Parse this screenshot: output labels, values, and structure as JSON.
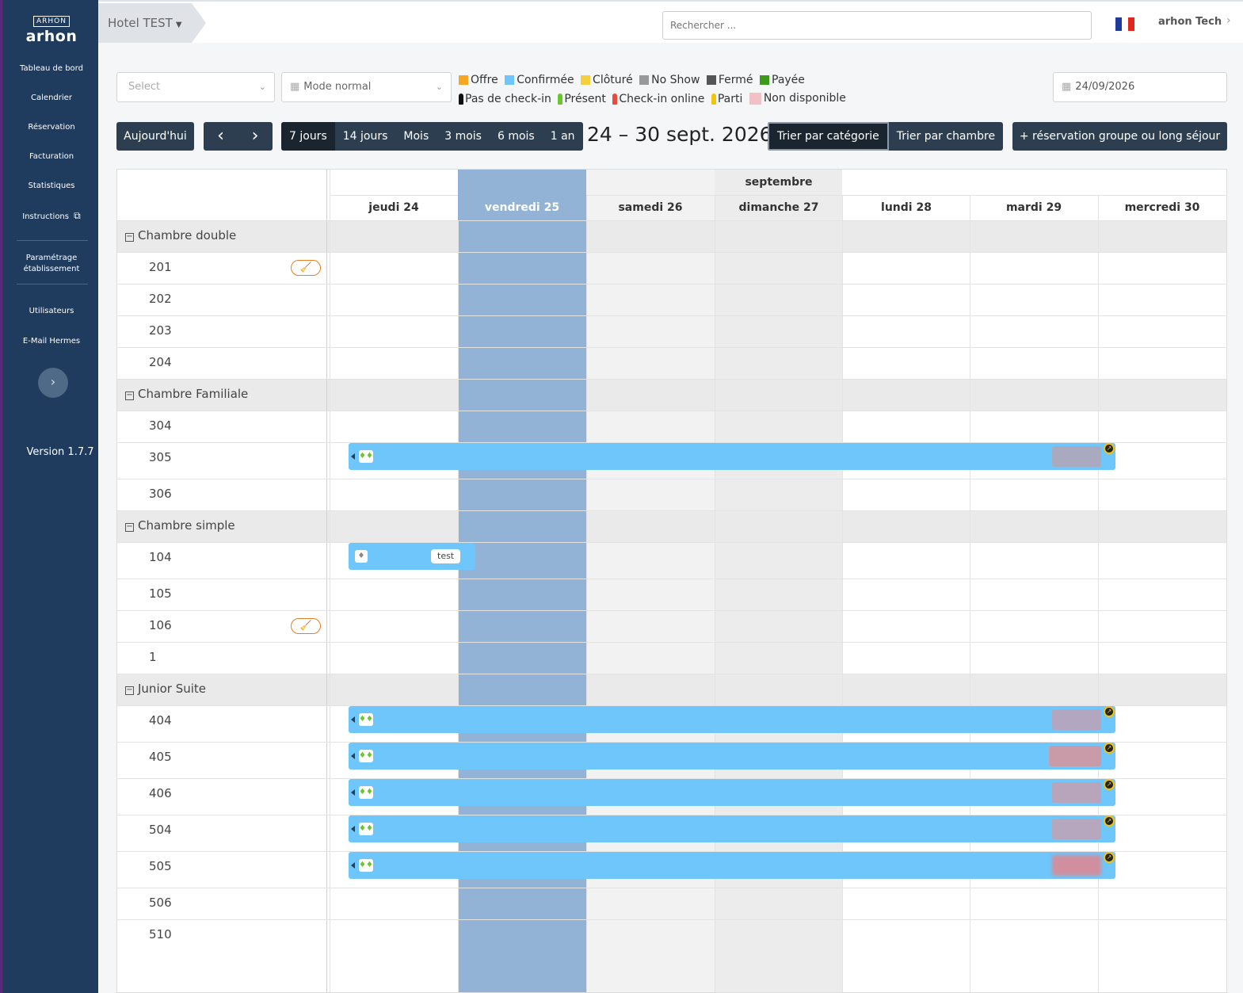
{
  "sidebar": {
    "logo_mark": "ARHON",
    "logo_text": "arhon",
    "items": [
      {
        "label": "Tableau de bord"
      },
      {
        "label": "Calendrier"
      },
      {
        "label": "Réservation"
      },
      {
        "label": "Facturation"
      },
      {
        "label": "Statistiques"
      },
      {
        "label": "Instructions"
      },
      {
        "label": "Paramétrage établissement"
      },
      {
        "label": "Utilisateurs"
      },
      {
        "label": "E-Mail Hermes"
      }
    ],
    "version": "Version 1.7.7"
  },
  "topbar": {
    "hotel": "Hotel TEST",
    "search_placeholder": "Rechercher ...",
    "user": "arhon Tech"
  },
  "filters": {
    "select_placeholder": "Select",
    "mode": "Mode normal",
    "date": "24/09/2026"
  },
  "legend": {
    "statuses": [
      {
        "label": "Offre",
        "color": "#f5a623"
      },
      {
        "label": "Confirmée",
        "color": "#6ec6fb"
      },
      {
        "label": "Clôturé",
        "color": "#f4d03f"
      },
      {
        "label": "No Show",
        "color": "#999999"
      },
      {
        "label": "Fermé",
        "color": "#555555"
      },
      {
        "label": "Payée",
        "color": "#3a9a1a"
      }
    ],
    "checkins": [
      {
        "label": "Pas de check-in",
        "color": "#111111"
      },
      {
        "label": "Présent",
        "color": "#6cc52d"
      },
      {
        "label": "Check-in online",
        "color": "#e74c3c"
      },
      {
        "label": "Parti",
        "color": "#f1c40f"
      },
      {
        "label": "Non disponible",
        "color": "#f2c1c5"
      }
    ]
  },
  "toolbar": {
    "today": "Aujourd'hui",
    "prev": "‹",
    "next": "›",
    "views": [
      "7 jours",
      "14 jours",
      "Mois",
      "3 mois",
      "6 mois",
      "1 an"
    ],
    "active_view": "7 jours",
    "range_title": "24 – 30 sept. 2026",
    "sort_category": "Trier par catégorie",
    "sort_room": "Trier par chambre",
    "group_booking": "+ réservation groupe ou long séjour"
  },
  "calendar": {
    "month": "septembre",
    "days": [
      "jeudi 24",
      "vendredi 25",
      "samedi 26",
      "dimanche 27",
      "lundi 28",
      "mardi 29",
      "mercredi 30"
    ],
    "today_index": 1,
    "categories": [
      {
        "name": "Chambre double",
        "rooms": [
          "201",
          "202",
          "203",
          "204"
        ]
      },
      {
        "name": "Chambre Familiale",
        "rooms": [
          "304",
          "305",
          "306"
        ]
      },
      {
        "name": "Chambre simple",
        "rooms": [
          "104",
          "105",
          "106",
          "1"
        ]
      },
      {
        "name": "Junior Suite",
        "rooms": [
          "404",
          "405",
          "406",
          "504",
          "505",
          "506",
          "510"
        ]
      }
    ],
    "reservation_tag": "test"
  }
}
